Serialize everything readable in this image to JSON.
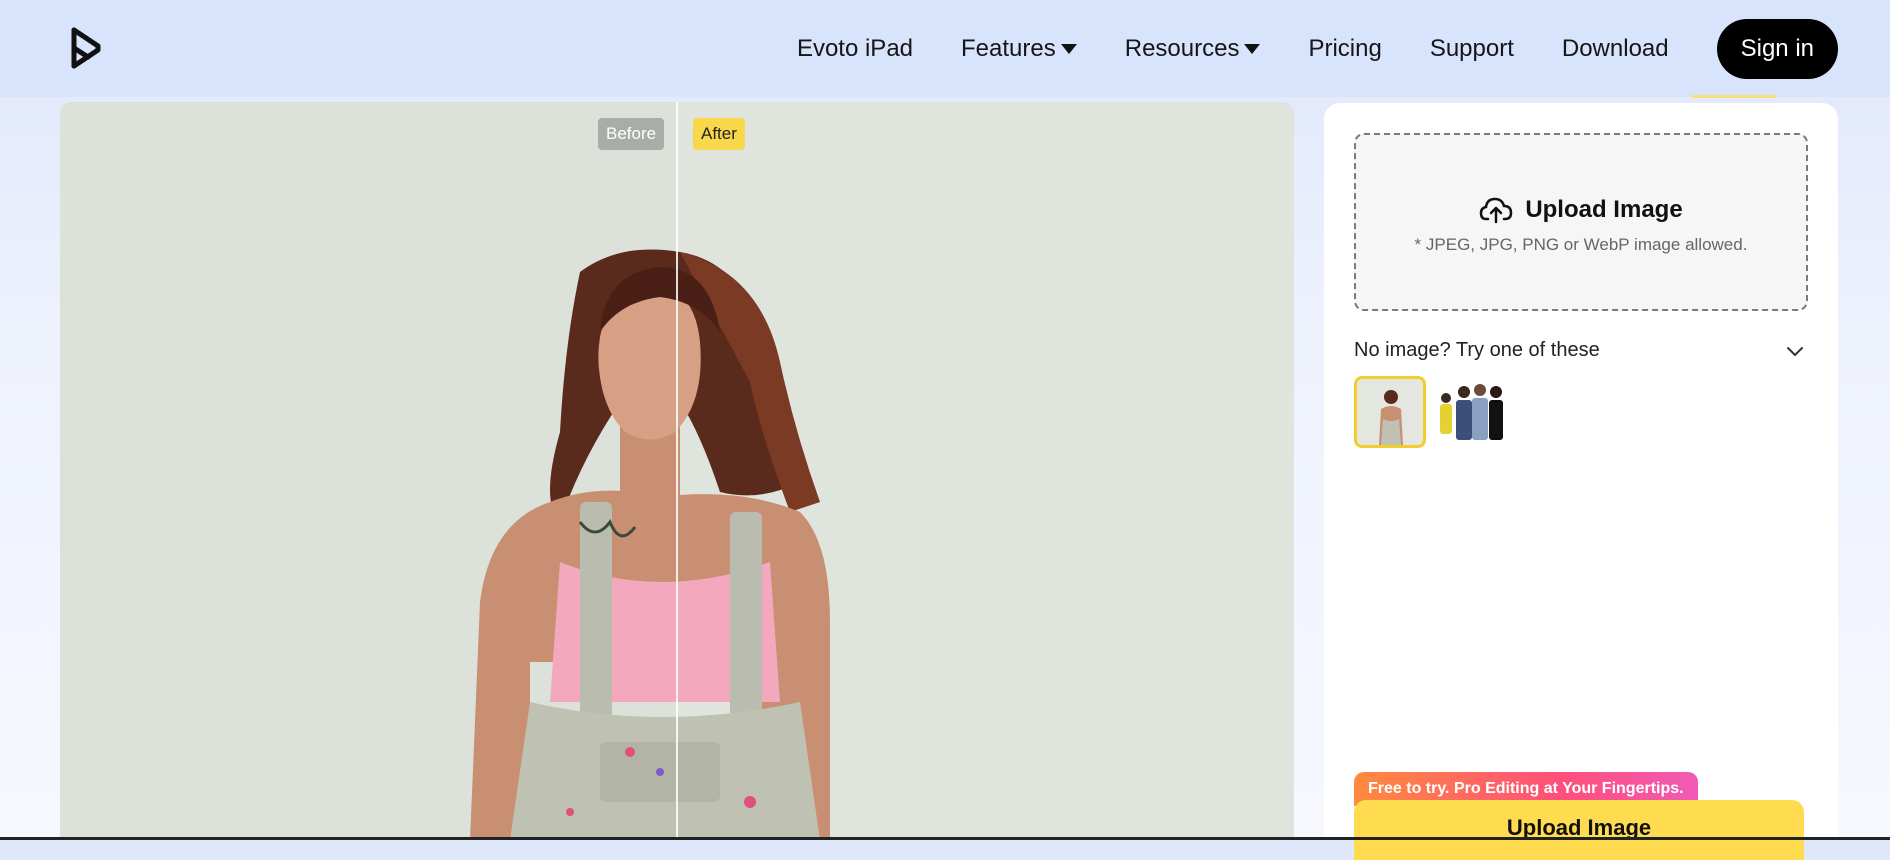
{
  "header": {
    "nav": [
      {
        "label": "Evoto iPad",
        "dropdown": false
      },
      {
        "label": "Features",
        "dropdown": true
      },
      {
        "label": "Resources",
        "dropdown": true
      },
      {
        "label": "Pricing",
        "dropdown": false
      },
      {
        "label": "Support",
        "dropdown": false
      },
      {
        "label": "Download",
        "dropdown": false
      }
    ],
    "signin_label": "Sign in"
  },
  "preview": {
    "before_label": "Before",
    "after_label": "After"
  },
  "panel": {
    "upload_title": "Upload Image",
    "upload_hint": "* JPEG, JPG, PNG or WebP image allowed.",
    "samples_title": "No image? Try one of these",
    "promo_text": "Free to try. Pro Editing at Your Fingertips.",
    "cta_label": "Upload Image"
  },
  "colors": {
    "accent_yellow": "#fedb4f",
    "header_bg": "#d8e3fc",
    "signin_bg": "#000000"
  },
  "icons": [
    "evoto-logo-icon",
    "chevron-down-icon",
    "cloud-upload-icon"
  ]
}
